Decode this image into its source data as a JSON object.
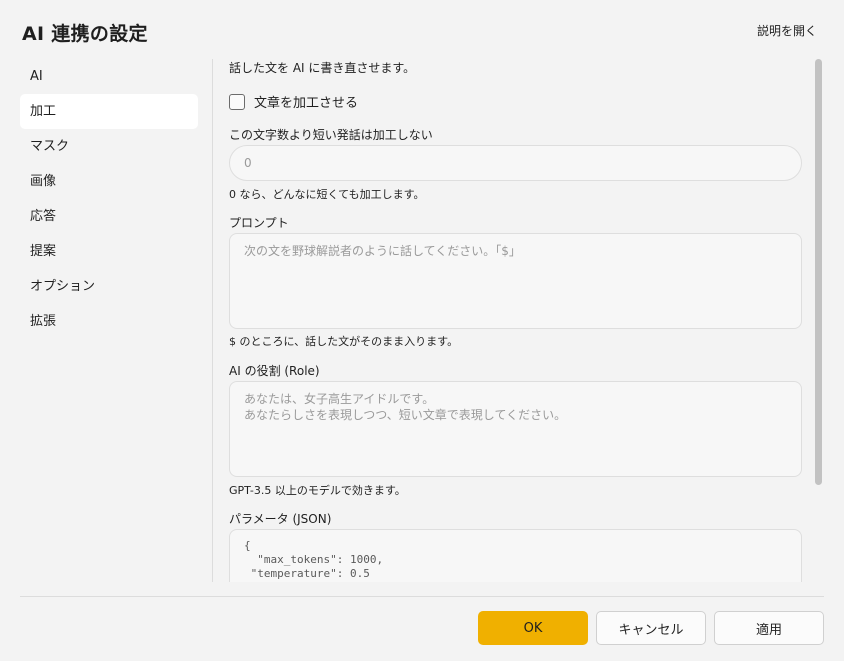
{
  "window": {
    "title": "AI 連携の設定",
    "help_link": "説明を開く"
  },
  "sidebar": {
    "items": [
      {
        "label": "AI"
      },
      {
        "label": "加工"
      },
      {
        "label": "マスク"
      },
      {
        "label": "画像"
      },
      {
        "label": "応答"
      },
      {
        "label": "提案"
      },
      {
        "label": "オプション"
      },
      {
        "label": "拡張"
      }
    ],
    "active_index": 1
  },
  "content": {
    "description": "話した文を AI に書き直させます。",
    "enable_checkbox": {
      "label": "文章を加工させる",
      "checked": false
    },
    "min_length": {
      "label": "この文字数より短い発話は加工しない",
      "placeholder": "0",
      "hint": "0 なら、どんなに短くても加工します。"
    },
    "prompt": {
      "label": "プロンプト",
      "placeholder": "次の文を野球解説者のように話してください。「$」",
      "hint": "$ のところに、話した文がそのまま入ります。"
    },
    "role": {
      "label": "AI の役割 (Role)",
      "placeholder_line1": "あなたは、女子高生アイドルです。",
      "placeholder_line2": "あなたらしさを表現しつつ、短い文章で表現してください。",
      "hint": "GPT-3.5 以上のモデルで効きます。"
    },
    "params": {
      "label": "パラメータ (JSON)",
      "line1": "{",
      "line2": "  \"max_tokens\": 1000,",
      "line3": " \"temperature\": 0.5"
    }
  },
  "footer": {
    "ok_label": "OK",
    "cancel_label": "キャンセル",
    "apply_label": "適用"
  },
  "colors": {
    "accent": "#f0b000",
    "active_nav": "#ffffff",
    "background": "#f3f3f3"
  }
}
